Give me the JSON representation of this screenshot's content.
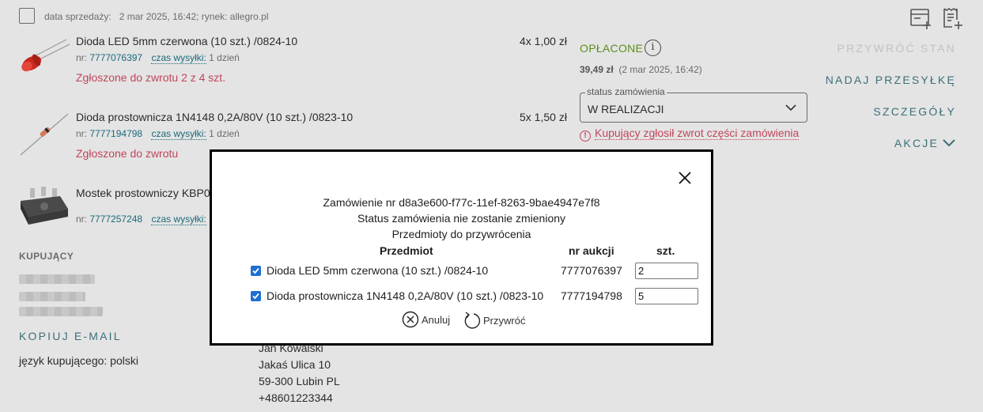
{
  "header": {
    "sale_date_label": "data sprzedaży:",
    "sale_date_value": "2 mar 2025, 16:42; rynek: allegro.pl",
    "icons": [
      "invoice-add-icon",
      "receipt-add-icon"
    ]
  },
  "items": [
    {
      "title": "Dioda LED 5mm czerwona (10 szt.) /0824-10",
      "nr_label": "nr:",
      "nr_value": "7777076397",
      "ship_label": "czas wysyłki:",
      "ship_value": "1 dzień",
      "qty": "4x 1,00 zł",
      "return_status": "Zgłoszone do zwrotu 2 z 4 szt.",
      "thumb_icon": "led-diode-image"
    },
    {
      "title": "Dioda prostownicza 1N4148 0,2A/80V (10 szt.) /0823-10",
      "nr_label": "nr:",
      "nr_value": "7777194798",
      "ship_label": "czas wysyłki:",
      "ship_value": "1 dzień",
      "qty": "5x 1,50 zł",
      "return_status": "Zgłoszone do zwrotu",
      "thumb_icon": "rectifier-diode-image"
    },
    {
      "title": "Mostek prostowniczy KBP0",
      "nr_label": "nr:",
      "nr_value": "7777257248",
      "ship_label": "czas wysyłki:",
      "thumb_icon": "bridge-rectifier-image"
    }
  ],
  "payment": {
    "status": "OPŁACONE",
    "amount": "39,49 zł",
    "date": "(2 mar 2025, 16:42)"
  },
  "order_status": {
    "legend": "status zamówienia",
    "value": "W REALIZACJI",
    "warning": "Kupujący zgłosił zwrot części zamówienia"
  },
  "actions": {
    "restore": "PRZYWRÓĆ STAN",
    "ship": "NADAJ PRZESYŁKĘ",
    "details": "SZCZEGÓŁY",
    "more": "AKCJE"
  },
  "buyer": {
    "heading": "KUPUJĄCY",
    "copy_email": "KOPIUJ E-MAIL",
    "language": "język kupującego: polski"
  },
  "address": {
    "name": "Jan Kowalski",
    "street": "Jakaś Ulica 10",
    "city": "59-300 Lubin PL",
    "phone": "+48601223344"
  },
  "modal": {
    "order_line": "Zamówienie nr d8a3e600-f77c-11ef-8263-9bae4947e7f8",
    "status_line": "Status zamówienia nie zostanie zmieniony",
    "items_heading": "Przedmioty do przywrócenia",
    "columns": {
      "item": "Przedmiot",
      "auction": "nr aukcji",
      "qty": "szt."
    },
    "rows": [
      {
        "name": "Dioda LED 5mm czerwona (10 szt.) /0824-10",
        "auction": "7777076397",
        "qty": "2",
        "checked": true
      },
      {
        "name": "Dioda prostownicza 1N4148 0,2A/80V (10 szt.) /0823-10",
        "auction": "7777194798",
        "qty": "5",
        "checked": true
      }
    ],
    "cancel_label": "Anuluj",
    "restore_label": "Przywróć"
  },
  "colors": {
    "background": "#e4e4e4",
    "accent_teal": "#3b6f7a",
    "paid_green": "#5a8f1a",
    "return_red": "#c0465b",
    "checkbox_blue": "#1f6fd1"
  }
}
